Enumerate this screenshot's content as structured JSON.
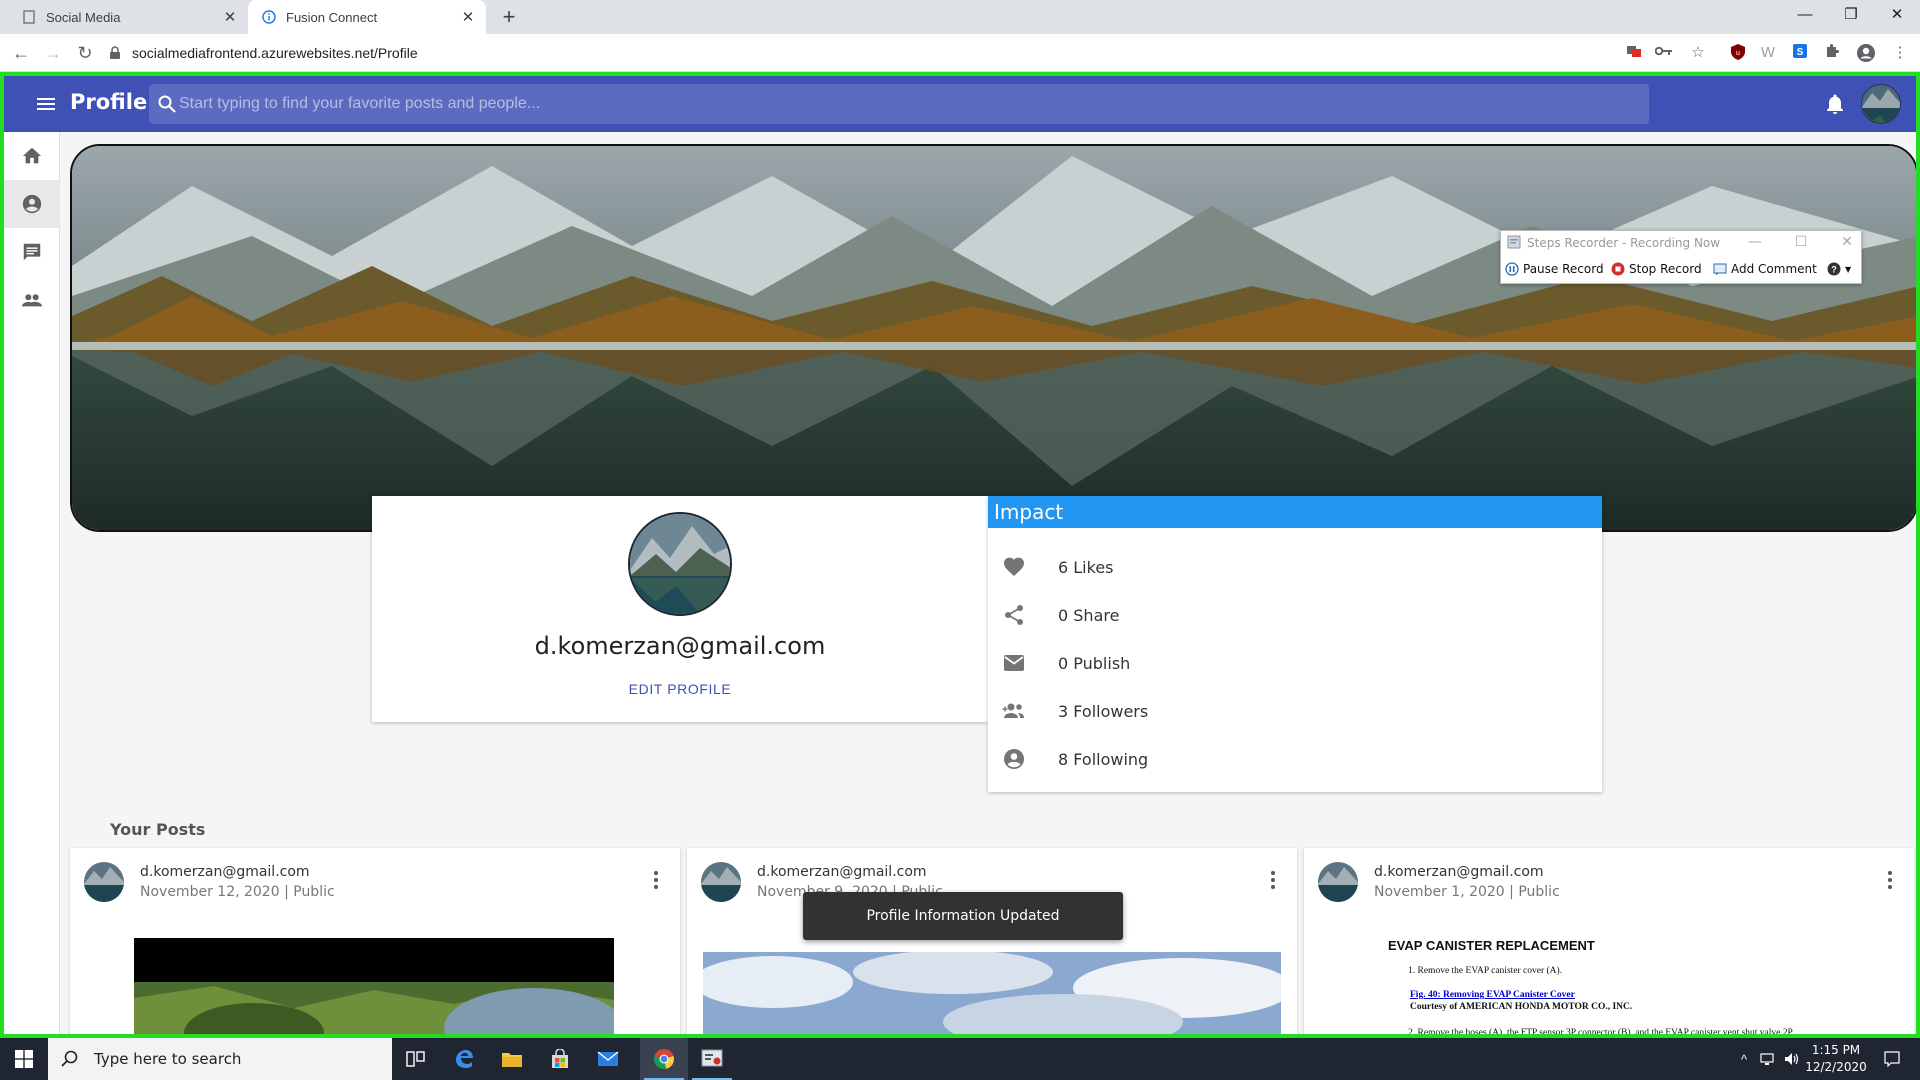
{
  "browser": {
    "tabs": [
      {
        "title": "Social Media",
        "active": false
      },
      {
        "title": "Fusion Connect",
        "active": true
      }
    ],
    "url": "socialmediafrontend.azurewebsites.net/Profile"
  },
  "appbar": {
    "title": "Profile",
    "search_placeholder": "Start typing to find your favorite posts and people..."
  },
  "sidebar": {
    "items": [
      {
        "icon": "home-icon",
        "selected": false
      },
      {
        "icon": "account-circle-icon",
        "selected": true
      },
      {
        "icon": "chat-icon",
        "selected": false
      },
      {
        "icon": "people-icon",
        "selected": false
      }
    ]
  },
  "profile": {
    "email": "d.komerzan@gmail.com",
    "edit_label": "EDIT PROFILE"
  },
  "impact": {
    "title": "Impact",
    "stats": [
      {
        "icon": "heart-icon",
        "label": "6 Likes"
      },
      {
        "icon": "share-icon",
        "label": "0 Share"
      },
      {
        "icon": "mail-icon",
        "label": "0 Publish"
      },
      {
        "icon": "followers-icon",
        "label": "3 Followers"
      },
      {
        "icon": "account-icon",
        "label": "8 Following"
      }
    ]
  },
  "posts": {
    "heading": "Your Posts",
    "items": [
      {
        "author": "d.komerzan@gmail.com",
        "meta": "November 12, 2020 | Public"
      },
      {
        "author": "d.komerzan@gmail.com",
        "meta": "November 9, 2020 | Public"
      },
      {
        "author": "d.komerzan@gmail.com",
        "meta": "November 1, 2020 | Public"
      }
    ],
    "doc": {
      "title": "EVAP CANISTER REPLACEMENT",
      "line1": "1.   Remove the EVAP canister cover (A).",
      "link": "Fig. 40: Removing EVAP Canister Cover",
      "courtesy": "Courtesy of AMERICAN HONDA MOTOR CO., INC.",
      "line2": "2.   Remove the hoses (A), the FTP sensor 3P connector (B), and the EVAP canister vent shut valve 2P"
    }
  },
  "toast": {
    "message": "Profile Information Updated"
  },
  "recorder": {
    "title": "Steps Recorder - Recording Now",
    "pause": "Pause Record",
    "stop": "Stop Record",
    "comment": "Add Comment"
  },
  "taskbar": {
    "search_placeholder": "Type here to search",
    "time": "1:15 PM",
    "date": "12/2/2020"
  },
  "colors": {
    "appbar": "#3f51b5",
    "impact_header": "#2196f3",
    "recorder_border": "#22dd22"
  }
}
